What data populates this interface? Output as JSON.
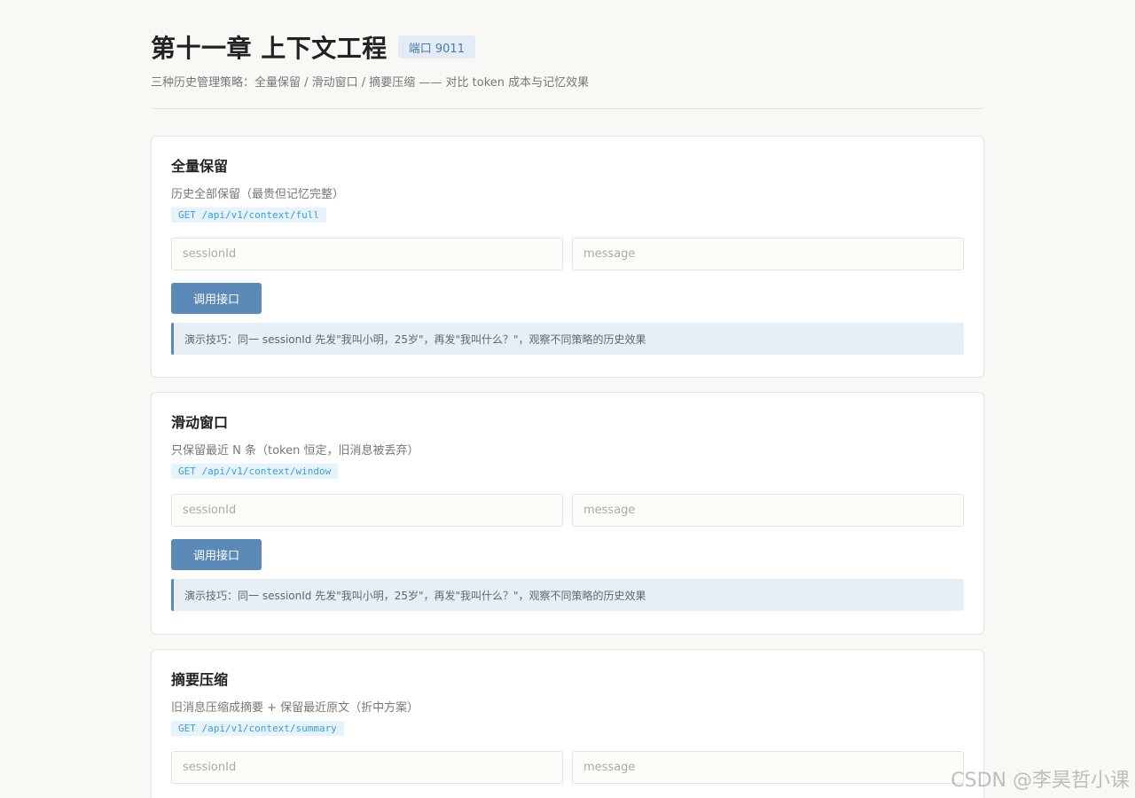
{
  "header": {
    "title": "第十一章 上下文工程",
    "port_badge": "端口 9011",
    "subtitle": "三种历史管理策略：全量保留 / 滑动窗口 / 摘要压缩 —— 对比 token 成本与记忆效果"
  },
  "cards": [
    {
      "title": "全量保留",
      "description": "历史全部保留（最贵但记忆完整）",
      "endpoint": "GET /api/v1/context/full",
      "session_placeholder": "sessionId",
      "message_placeholder": "message",
      "button_label": "调用接口",
      "tip": "演示技巧：同一 sessionId 先发\"我叫小明，25岁\"，再发\"我叫什么？\"，观察不同策略的历史效果"
    },
    {
      "title": "滑动窗口",
      "description": "只保留最近 N 条（token 恒定，旧消息被丢弃）",
      "endpoint": "GET /api/v1/context/window",
      "session_placeholder": "sessionId",
      "message_placeholder": "message",
      "button_label": "调用接口",
      "tip": "演示技巧：同一 sessionId 先发\"我叫小明，25岁\"，再发\"我叫什么？\"，观察不同策略的历史效果"
    },
    {
      "title": "摘要压缩",
      "description": "旧消息压缩成摘要 + 保留最近原文（折中方案）",
      "endpoint": "GET /api/v1/context/summary",
      "session_placeholder": "sessionId",
      "message_placeholder": "message"
    }
  ],
  "watermark": "CSDN @李昊哲小课"
}
